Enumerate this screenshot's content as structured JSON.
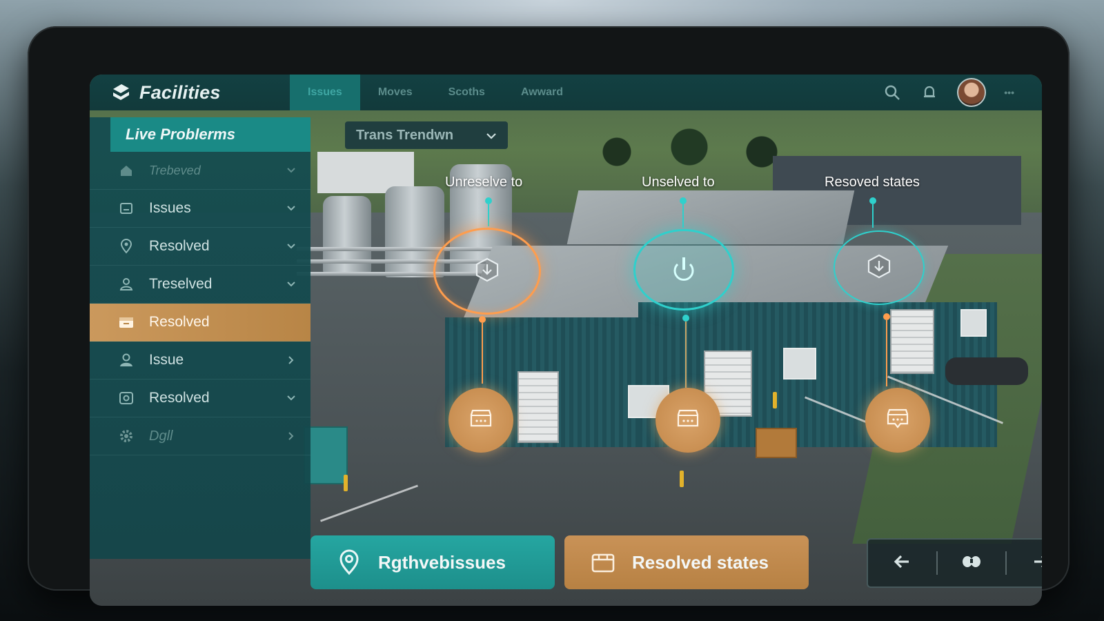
{
  "app": {
    "title": "Facilities"
  },
  "nav": {
    "tabs": [
      {
        "label": "Issues"
      },
      {
        "label": "Moves"
      },
      {
        "label": "Scoths"
      },
      {
        "label": "Awward"
      }
    ],
    "user_menu": "•••"
  },
  "sidebar": {
    "header": "Live Problerms",
    "items": [
      {
        "label": "Trebeved",
        "icon": "home-icon"
      },
      {
        "label": "Issues",
        "icon": "issues-icon"
      },
      {
        "label": "Resolved",
        "icon": "location-pin-icon"
      },
      {
        "label": "Treselved",
        "icon": "user-icon"
      },
      {
        "label": "Resolved",
        "icon": "box-icon"
      },
      {
        "label": "Issue",
        "icon": "person-icon"
      },
      {
        "label": "Resolved",
        "icon": "settings-icon"
      },
      {
        "label": "Dgll",
        "icon": "gear-icon"
      }
    ]
  },
  "filter": {
    "value": "Trans Trendwn"
  },
  "hotspots": [
    {
      "label": "Unreselve to",
      "status": "unresolved",
      "color": "#ff9d4d"
    },
    {
      "label": "Unselved to",
      "status": "unresolved",
      "color": "#2fd0cc"
    },
    {
      "label": "Resoved states",
      "status": "resolved",
      "color": "#2fd0cc"
    }
  ],
  "actions": {
    "primary": "Rgthvebissues",
    "secondary": "Resolved states"
  },
  "colors": {
    "accent_teal": "#1d8f8b",
    "accent_gold": "#c99257",
    "header_bg": "#113f42"
  }
}
